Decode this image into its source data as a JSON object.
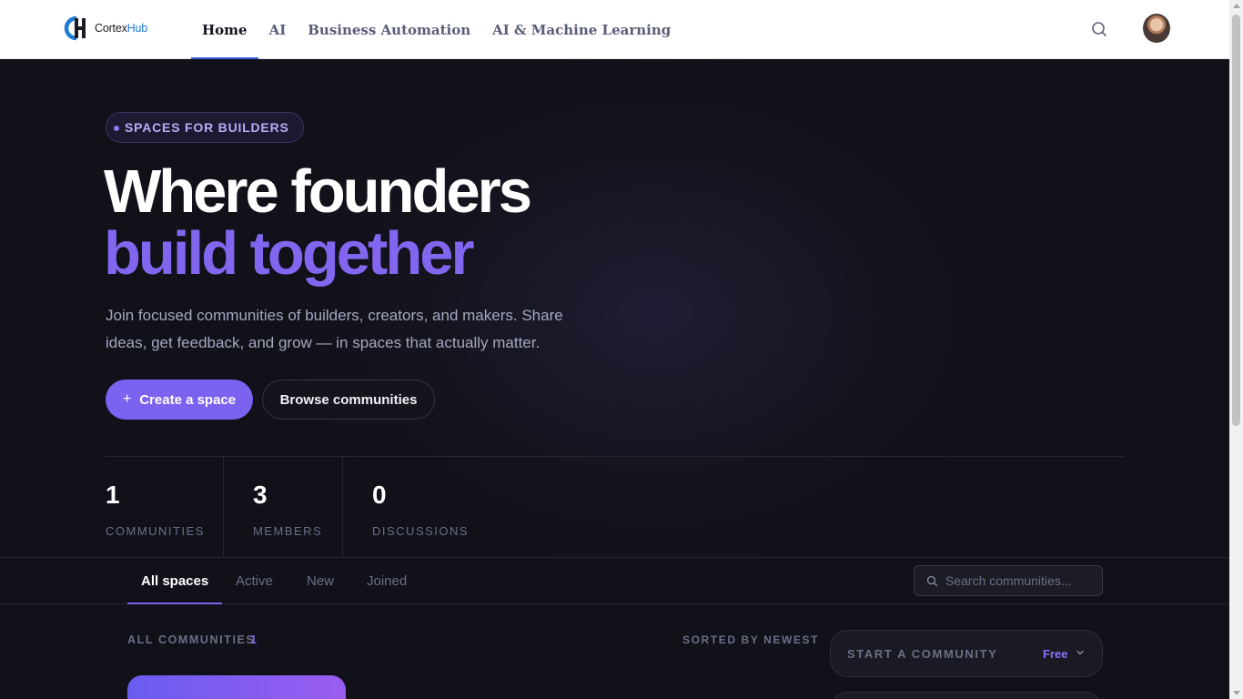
{
  "brand": {
    "name_prefix": "Cortex",
    "name_suffix": "Hub"
  },
  "nav": {
    "items": [
      {
        "label": "Home",
        "active": true
      },
      {
        "label": "AI",
        "active": false
      },
      {
        "label": "Business Automation",
        "active": false
      },
      {
        "label": "AI & Machine Learning",
        "active": false
      }
    ]
  },
  "hero": {
    "badge": "SPACES FOR BUILDERS",
    "headline_line1": "Where founders",
    "headline_line2": "build together",
    "subtitle": "Join focused communities of builders, creators, and makers. Share ideas, get feedback, and grow — in spaces that actually matter.",
    "primary_button": "Create a space",
    "secondary_button": "Browse communities"
  },
  "stats": [
    {
      "value": "1",
      "label": "COMMUNITIES"
    },
    {
      "value": "3",
      "label": "MEMBERS"
    },
    {
      "value": "0",
      "label": "DISCUSSIONS"
    }
  ],
  "tabs": [
    {
      "label": "All spaces",
      "active": true
    },
    {
      "label": "Active",
      "active": false
    },
    {
      "label": "New",
      "active": false
    },
    {
      "label": "Joined",
      "active": false
    }
  ],
  "search": {
    "placeholder": "Search communities..."
  },
  "list": {
    "section_label": "ALL COMMUNITIES",
    "count": "1",
    "sort_label": "SORTED BY NEWEST"
  },
  "start_panel": {
    "label": "START A COMMUNITY",
    "tier": "Free"
  },
  "colors": {
    "accent": "#7b62f0",
    "background": "#11111a",
    "nav_underline": "#3a5bd9"
  }
}
